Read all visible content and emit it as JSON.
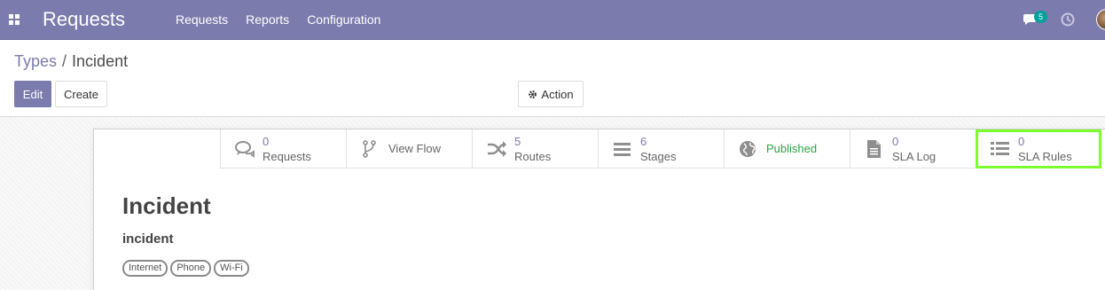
{
  "navbar": {
    "brand": "Requests",
    "menu": [
      "Requests",
      "Reports",
      "Configuration"
    ],
    "chat_badge": "5",
    "bg_color": "#7c7bad"
  },
  "breadcrumb": {
    "parent": "Types",
    "separator": "/",
    "current": "Incident"
  },
  "control": {
    "edit_label": "Edit",
    "create_label": "Create",
    "action_label": "Action"
  },
  "button_box": {
    "requests": {
      "count": "0",
      "label": "Requests",
      "icon": "comments-icon"
    },
    "view_flow": {
      "label": "View Flow",
      "icon": "flow-icon"
    },
    "routes": {
      "count": "5",
      "label": "Routes",
      "icon": "shuffle-icon"
    },
    "stages": {
      "count": "6",
      "label": "Stages",
      "icon": "bars-icon"
    },
    "published": {
      "label": "Published",
      "icon": "globe-icon",
      "color": "#28a745"
    },
    "sla_log": {
      "count": "0",
      "label": "SLA Log",
      "icon": "file-icon"
    },
    "sla_rules": {
      "count": "0",
      "label": "SLA Rules",
      "icon": "list-icon",
      "highlight_color": "#7cff2b"
    }
  },
  "record": {
    "name": "Incident",
    "code": "incident",
    "tags": [
      "Internet",
      "Phone",
      "Wi-Fi"
    ]
  }
}
